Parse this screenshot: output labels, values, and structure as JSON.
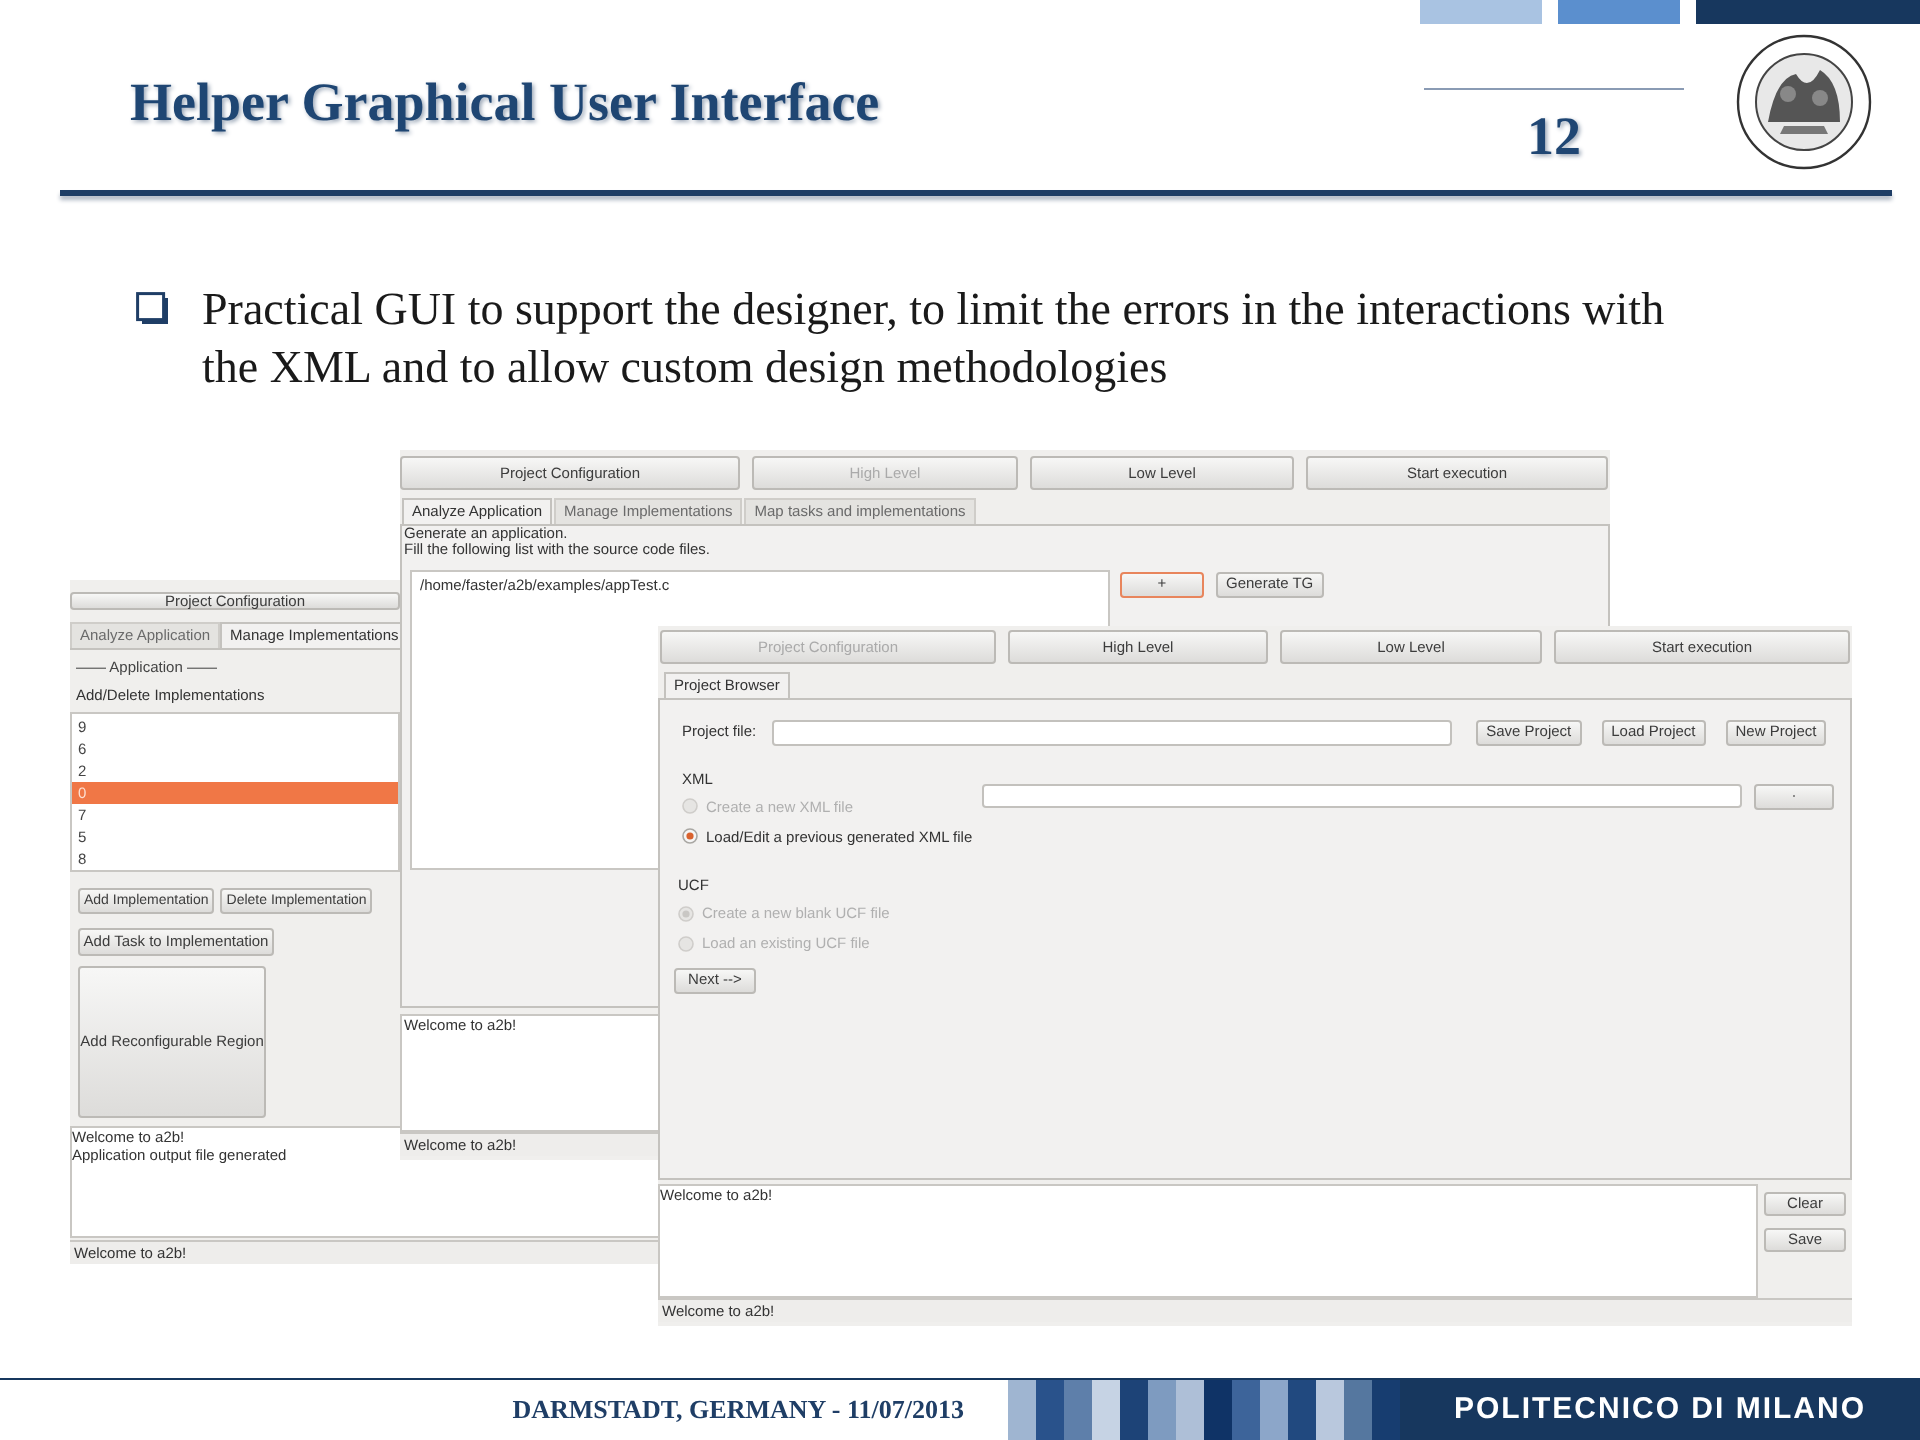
{
  "slide": {
    "title": "Helper Graphical User Interface",
    "page_number": "12",
    "bullets": [
      "Practical GUI to support the designer, to limit the errors in the interactions with the XML and to allow custom design methodologies"
    ]
  },
  "windows": [
    {
      "kind": "implementations",
      "top_button": {
        "label": "Project Configuration",
        "disabled": false
      },
      "tabs": [
        {
          "label": "Analyze Application",
          "selected": false
        },
        {
          "label": "Manage Implementations",
          "selected": true
        }
      ],
      "section": "—— Application ——",
      "heading": "Add/Delete Implementations",
      "items": [
        {
          "label": "9",
          "selected": false
        },
        {
          "label": "6",
          "selected": false
        },
        {
          "label": "2",
          "selected": false
        },
        {
          "label": "0",
          "selected": true
        },
        {
          "label": "7",
          "selected": false
        },
        {
          "label": "5",
          "selected": false
        },
        {
          "label": "8",
          "selected": false
        }
      ],
      "buttons": [
        "Add Implementation",
        "Delete Implementation"
      ],
      "task_button": "Add Task to Implementation",
      "region_button": "Add Reconfigurable Region",
      "log": [
        "Welcome to a2b!",
        "Application output file generated"
      ],
      "status": "Welcome to a2b!"
    },
    {
      "kind": "analyze",
      "top_buttons": [
        {
          "label": "Project Configuration",
          "disabled": false
        },
        {
          "label": "High Level",
          "disabled": true
        },
        {
          "label": "Low Level",
          "disabled": false
        },
        {
          "label": "Start execution",
          "disabled": false
        }
      ],
      "tabs": [
        {
          "label": "Analyze Application",
          "selected": true
        },
        {
          "label": "Manage Implementations",
          "selected": false
        },
        {
          "label": "Map tasks and implementations",
          "selected": false
        }
      ],
      "instructions": [
        "Generate an application.",
        "Fill the following list with the source code files."
      ],
      "files": [
        "/home/faster/a2b/examples/appTest.c"
      ],
      "actions": [
        {
          "label": "+",
          "focused": true
        },
        {
          "label": "Generate TG",
          "focused": false
        }
      ],
      "log": [
        "Welcome to a2b!"
      ],
      "status": "Welcome to a2b!"
    },
    {
      "kind": "project",
      "top_buttons": [
        {
          "label": "Project Configuration",
          "disabled": true
        },
        {
          "label": "High Level",
          "disabled": false
        },
        {
          "label": "Low Level",
          "disabled": false
        },
        {
          "label": "Start execution",
          "disabled": false
        }
      ],
      "tabs": [
        {
          "label": "Project Browser",
          "selected": true
        }
      ],
      "project_file_label": "Project file:",
      "project_buttons": [
        "Save Project",
        "Load Project",
        "New Project"
      ],
      "xml": {
        "label": "XML",
        "options": [
          {
            "label": "Create a new XML file",
            "selected": false,
            "disabled": true
          },
          {
            "label": "Load/Edit a previous generated XML file",
            "selected": true,
            "disabled": false
          }
        ],
        "browse_button": "·"
      },
      "ucf": {
        "label": "UCF",
        "options": [
          {
            "label": "Create a new blank UCF file",
            "selected": true,
            "disabled": true
          },
          {
            "label": "Load an existing UCF file",
            "selected": false,
            "disabled": true
          }
        ]
      },
      "next_button": "Next -->",
      "log": [
        "Welcome to a2b!"
      ],
      "log_buttons": [
        "Clear",
        "Save"
      ],
      "status": "Welcome to a2b!"
    }
  ],
  "footer": {
    "place_date": "DARMSTADT, GERMANY - 11/07/2013",
    "institution": "POLITECNICO DI MILANO"
  }
}
